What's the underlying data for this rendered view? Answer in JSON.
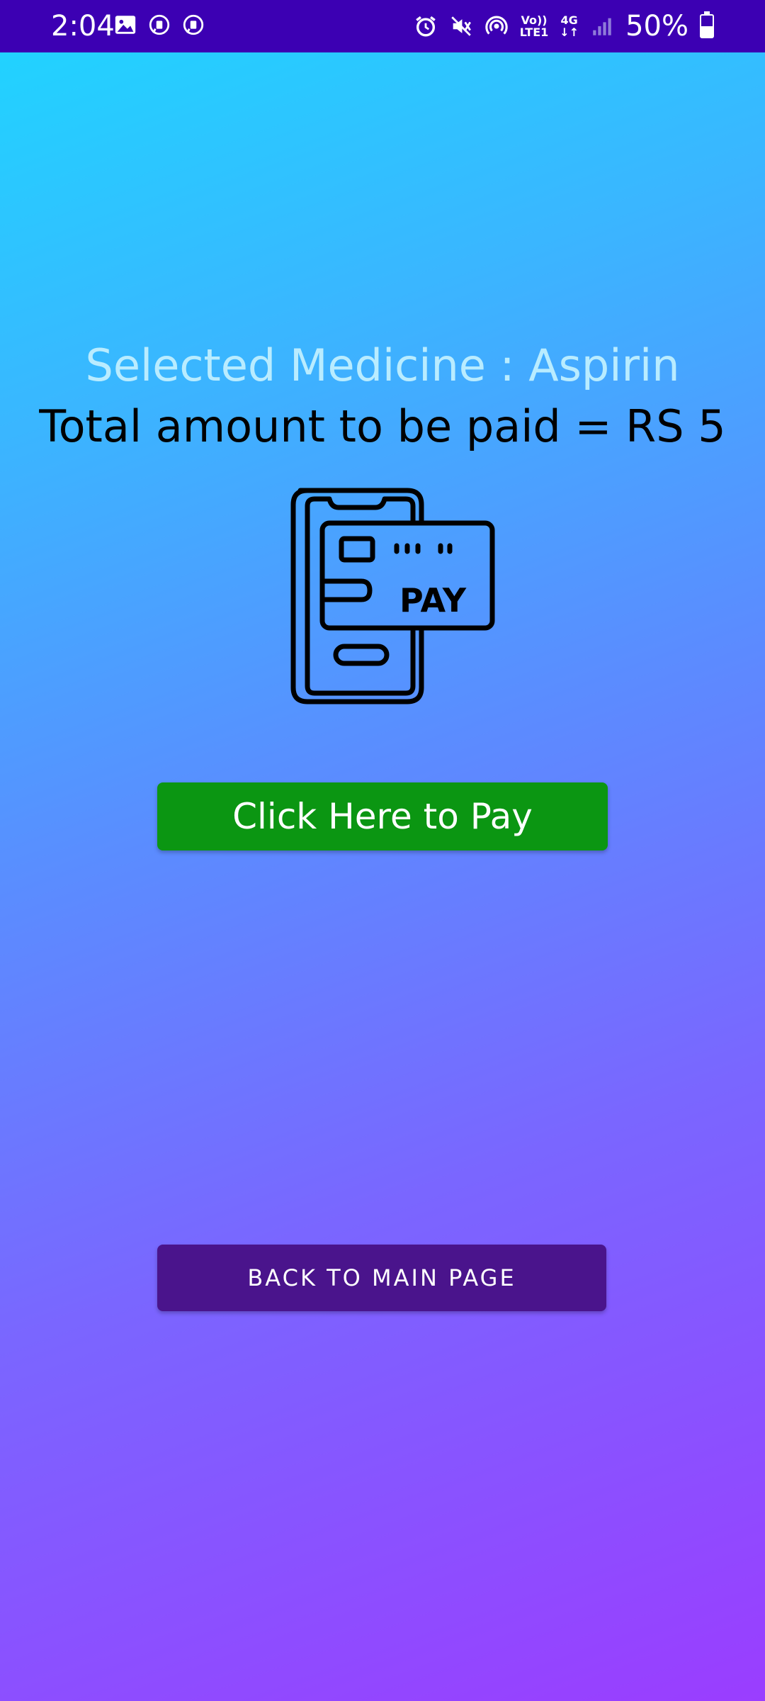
{
  "status_bar": {
    "time": "2:04",
    "left_icons": [
      "image-icon",
      "chat-bubble-icon",
      "chat-bubble-icon"
    ],
    "right_icons": [
      "alarm-icon",
      "vibrate-mute-icon",
      "hotspot-icon",
      "volte-icon",
      "4g-icon",
      "signal-icon",
      "battery-icon"
    ],
    "volte_label_top": "Vo))",
    "volte_label_bottom": "LTE1",
    "network_type": "4G",
    "battery_percent": "50%",
    "battery_level": 0.5,
    "background_color": "#3c00b3"
  },
  "main": {
    "selected_medicine_text": "Selected Medicine : Aspirin",
    "total_amount_text": "Total amount to be paid = RS 5",
    "illustration_label": "PAY",
    "illustration_icon": "mobile-payment-card-icon",
    "pay_button_label": "Click Here to Pay",
    "back_button_label": "BACK TO MAIN PAGE"
  },
  "colors": {
    "gradient_top": "#1ed6ff",
    "gradient_bottom": "#9a3dff",
    "pay_button": "#0b9612",
    "back_button": "#4a148c",
    "selected_medicine_text": "#b9ecff"
  }
}
